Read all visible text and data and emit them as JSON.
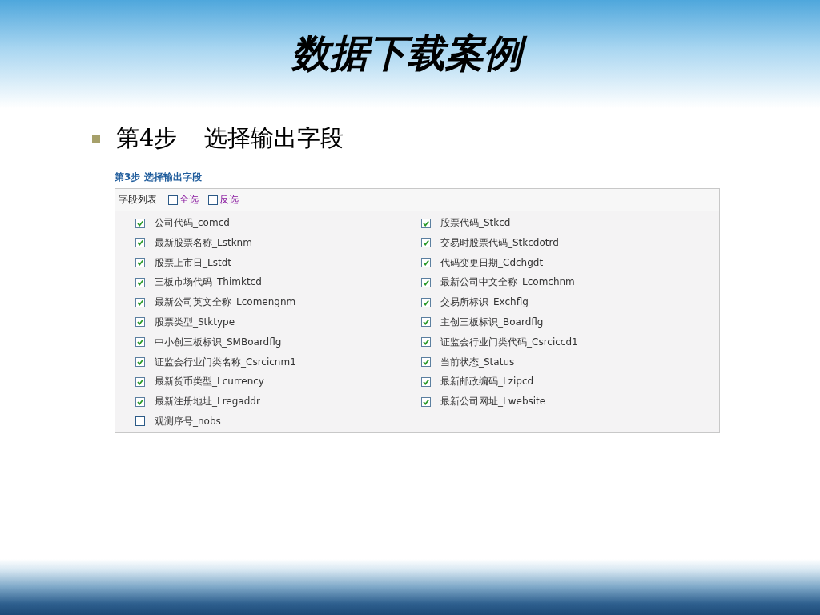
{
  "slide_title": "数据下载案例",
  "bullet": {
    "step_label": "第4步",
    "text": "选择输出字段"
  },
  "panel": {
    "title": "第3步 选择输出字段",
    "list_label": "字段列表",
    "select_all": {
      "label": "全选",
      "checked": false
    },
    "invert_select": {
      "label": "反选",
      "checked": false
    },
    "fields": [
      {
        "label": "公司代码_comcd",
        "checked": true
      },
      {
        "label": "股票代码_Stkcd",
        "checked": true
      },
      {
        "label": "最新股票名称_Lstknm",
        "checked": true
      },
      {
        "label": "交易时股票代码_Stkcdotrd",
        "checked": true
      },
      {
        "label": "股票上市日_Lstdt",
        "checked": true
      },
      {
        "label": "代码变更日期_Cdchgdt",
        "checked": true
      },
      {
        "label": "三板市场代码_Thimktcd",
        "checked": true
      },
      {
        "label": "最新公司中文全称_Lcomchnm",
        "checked": true
      },
      {
        "label": "最新公司英文全称_Lcomengnm",
        "checked": true
      },
      {
        "label": "交易所标识_Exchflg",
        "checked": true
      },
      {
        "label": "股票类型_Stktype",
        "checked": true
      },
      {
        "label": "主创三板标识_Boardflg",
        "checked": true
      },
      {
        "label": "中小创三板标识_SMBoardflg",
        "checked": true
      },
      {
        "label": "证监会行业门类代码_Csrciccd1",
        "checked": true
      },
      {
        "label": "证监会行业门类名称_Csrcicnm1",
        "checked": true
      },
      {
        "label": "当前状态_Status",
        "checked": true
      },
      {
        "label": "最新货币类型_Lcurrency",
        "checked": true
      },
      {
        "label": "最新邮政编码_Lzipcd",
        "checked": true
      },
      {
        "label": "最新注册地址_Lregaddr",
        "checked": true
      },
      {
        "label": "最新公司网址_Lwebsite",
        "checked": true
      },
      {
        "label": "观测序号_nobs",
        "checked": false
      }
    ]
  }
}
